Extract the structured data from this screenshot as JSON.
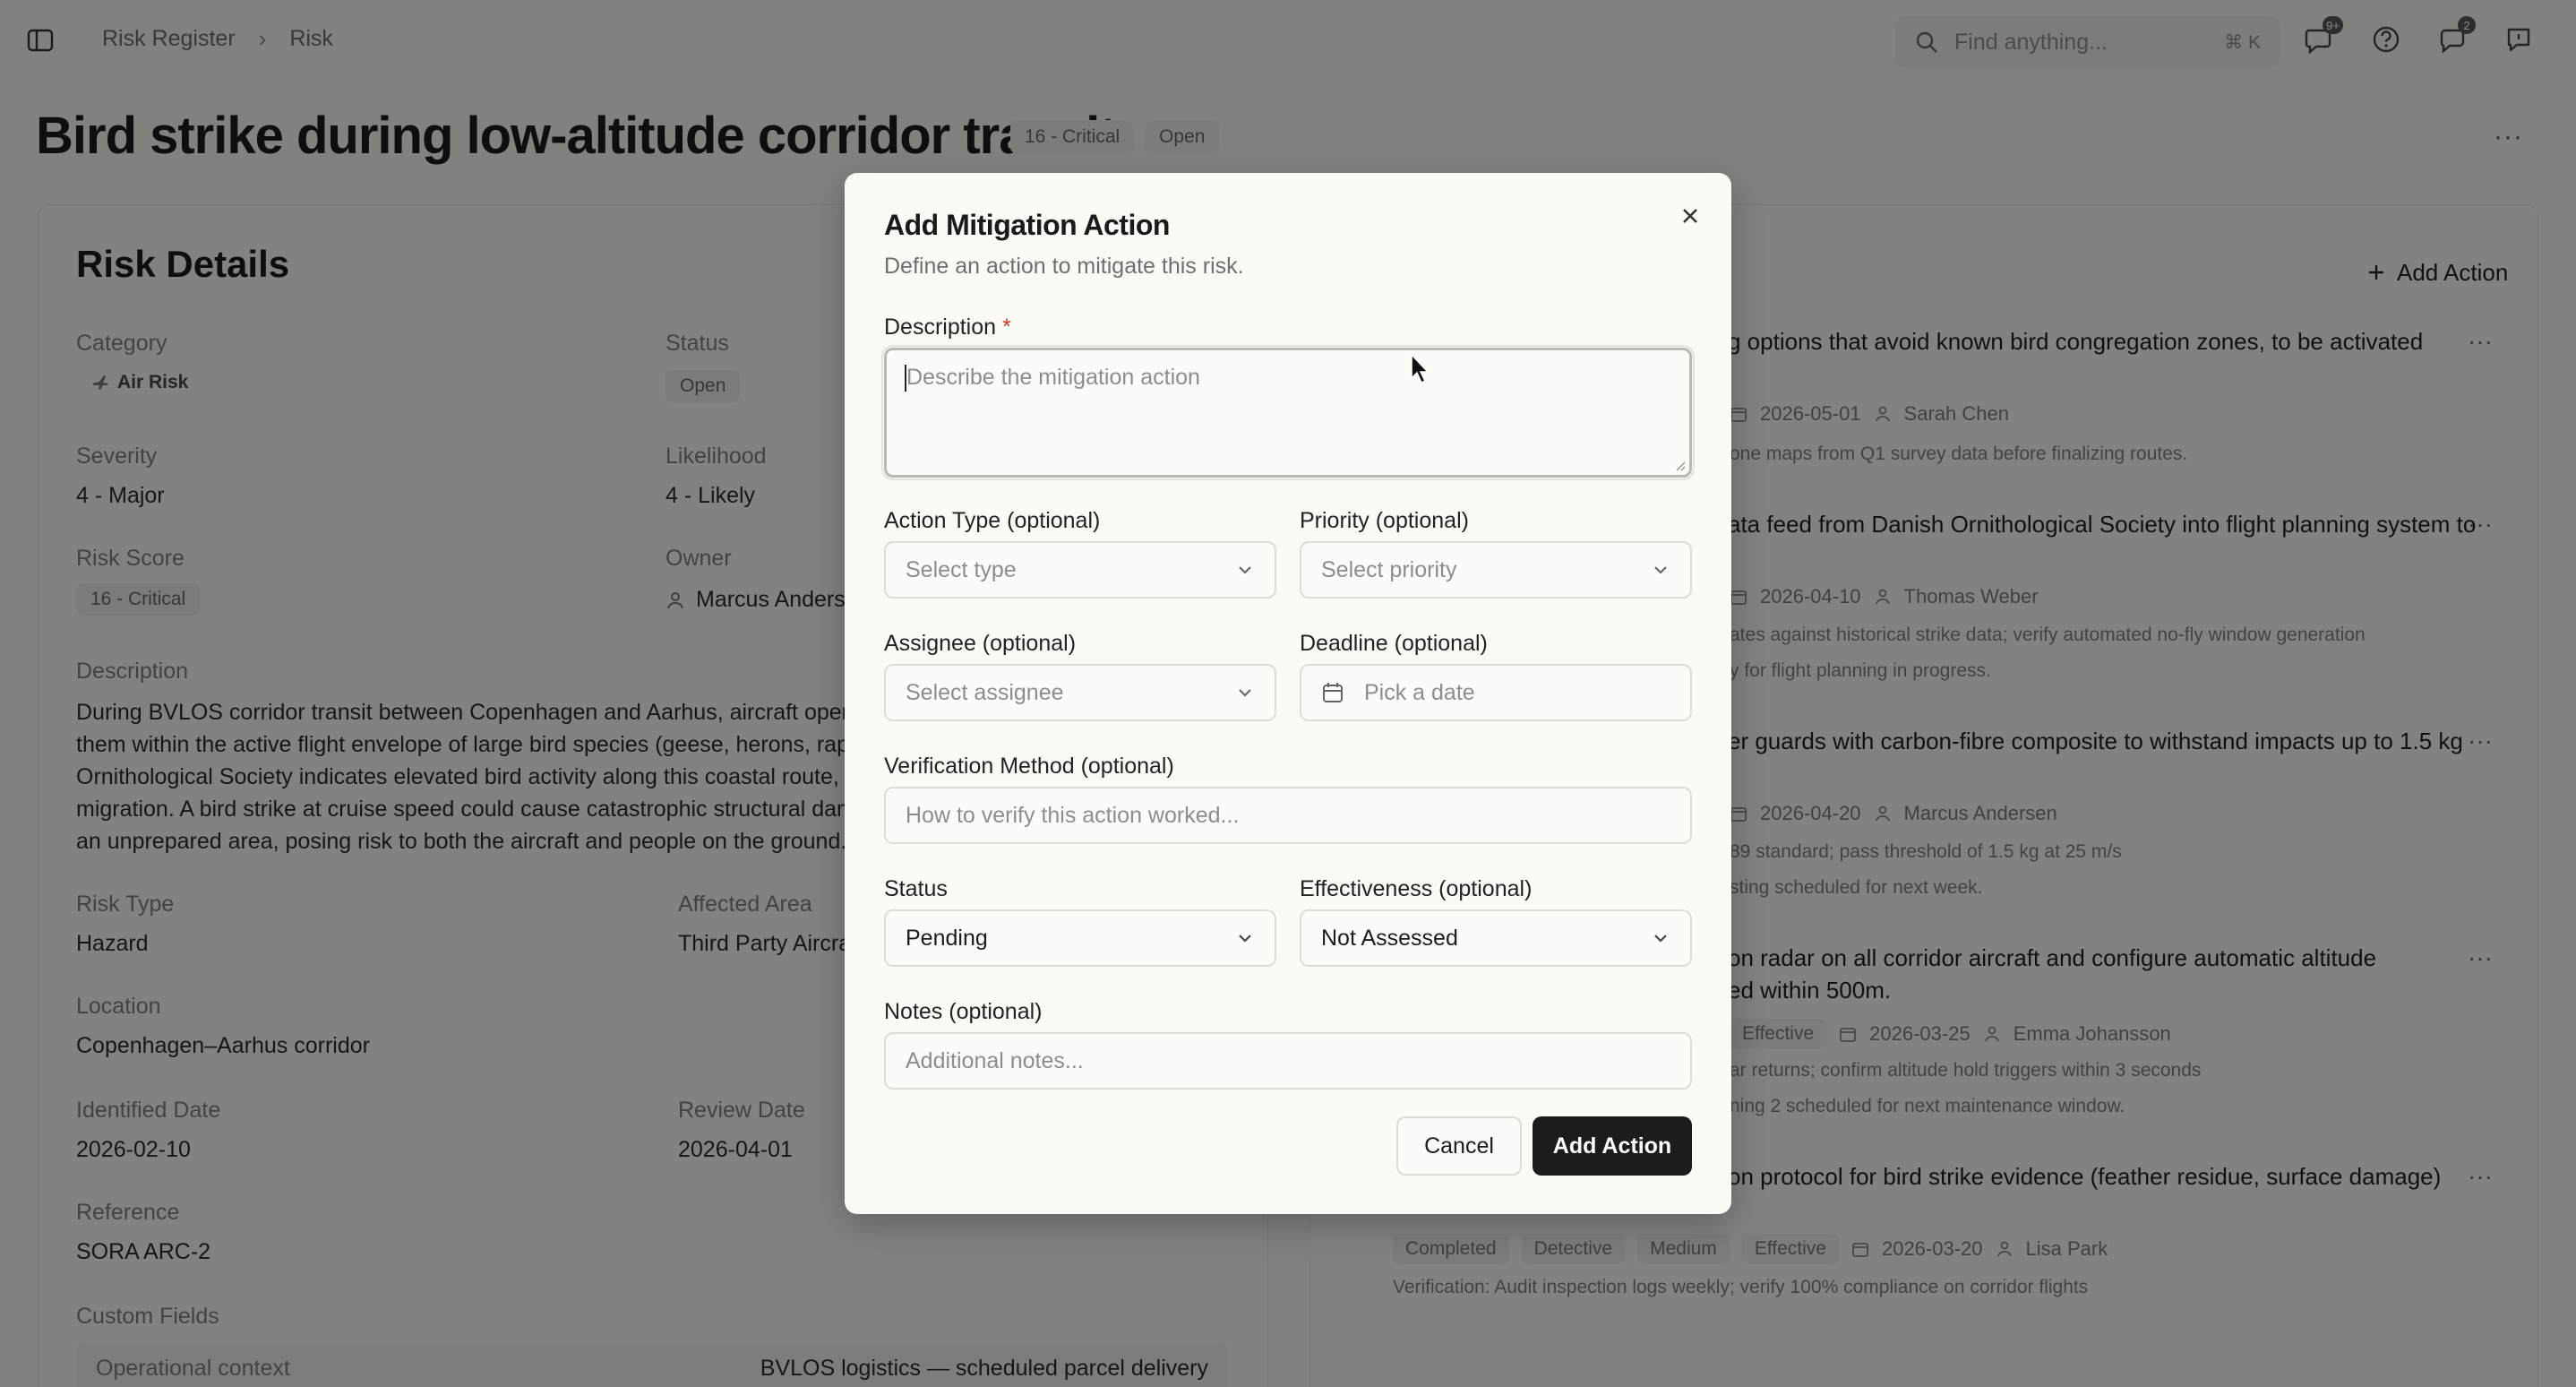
{
  "breadcrumb": [
    "Risk Register",
    "Risk"
  ],
  "search": {
    "placeholder": "Find anything...",
    "shortcut": "⌘ K"
  },
  "notifications_badge": "9+",
  "header_badge_count": "2",
  "page": {
    "title": "Bird strike during low-altitude corridor transit",
    "score_chip": "16 - Critical",
    "status_chip": "Open"
  },
  "risk_details": {
    "heading": "Risk Details",
    "category_label": "Category",
    "category_value": "Air Risk",
    "status_label": "Status",
    "status_value": "Open",
    "severity_label": "Severity",
    "severity_value": "4 - Major",
    "likelihood_label": "Likelihood",
    "likelihood_value": "4 - Likely",
    "score_label": "Risk Score",
    "score_value": "16 - Critical",
    "owner_label": "Owner",
    "owner_value": "Marcus Anders",
    "description_label": "Description",
    "description_lines": [
      "During BVLOS corridor transit between Copenhagen and Aarhus, aircraft operat",
      "them within the active flight envelope of large bird species (geese, herons, rapto",
      "Ornithological Society indicates elevated bird activity along this coastal route, p",
      "migration. A bird strike at cruise speed could cause catastrophic structural dam",
      "an unprepared area, posing risk to both the aircraft and people on the ground."
    ],
    "risk_type_label": "Risk Type",
    "risk_type_value": "Hazard",
    "affected_area_label": "Affected Area",
    "affected_area_value": "Third Party Aircra",
    "location_label": "Location",
    "location_value": "Copenhagen–Aarhus corridor",
    "identified_label": "Identified Date",
    "identified_value": "2026-02-10",
    "review_label": "Review Date",
    "review_value": "2026-04-01",
    "reference_label": "Reference",
    "reference_value": "SORA ARC-2",
    "custom_fields_label": "Custom Fields",
    "custom_field_key": "Operational context",
    "custom_field_value": "BVLOS logistics — scheduled parcel delivery"
  },
  "actions_panel": {
    "add_action_label": "Add Action",
    "items": [
      {
        "title": "g options that avoid known bird congregation zones, to be activated",
        "date": "2026-05-01",
        "assignee": "Sarah Chen",
        "notes": [
          "one maps from Q1 survey data before finalizing routes."
        ]
      },
      {
        "title": "ata feed from Danish Ornithological Society into flight planning system to",
        "date": "2026-04-10",
        "assignee": "Thomas Weber",
        "notes": [
          "ates against historical strike data; verify automated no-fly window generation",
          "y for flight planning in progress."
        ]
      },
      {
        "title": "er guards with carbon-fibre composite to withstand impacts up to 1.5 kg",
        "date": "2026-04-20",
        "assignee": "Marcus Andersen",
        "notes": [
          "89 standard; pass threshold of 1.5 kg at 25 m/s",
          "sting scheduled for next week."
        ]
      },
      {
        "title": "on radar on all corridor aircraft and configure automatic altitude",
        "title2": "ed within 500m.",
        "effectiveness": "Effective",
        "date": "2026-03-25",
        "assignee": "Emma Johansson",
        "notes": [
          "ar returns; confirm altitude hold triggers within 3 seconds",
          "ning 2 scheduled for next maintenance window."
        ]
      },
      {
        "title": "on protocol for bird strike evidence (feather residue, surface damage)",
        "status": "Completed",
        "type": "Detective",
        "priority": "Medium",
        "effectiveness": "Effective",
        "date": "2026-03-20",
        "assignee": "Lisa Park",
        "notes": [
          "Verification: Audit inspection logs weekly; verify 100% compliance on corridor flights"
        ]
      }
    ]
  },
  "modal": {
    "title": "Add Mitigation Action",
    "subtitle": "Define an action to mitigate this risk.",
    "description_label": "Description",
    "required_mark": "*",
    "description_placeholder": "Describe the mitigation action",
    "action_type_label": "Action Type (optional)",
    "action_type_placeholder": "Select type",
    "priority_label": "Priority (optional)",
    "priority_placeholder": "Select priority",
    "assignee_label": "Assignee (optional)",
    "assignee_placeholder": "Select assignee",
    "deadline_label": "Deadline (optional)",
    "deadline_placeholder": "Pick a date",
    "verification_label": "Verification Method (optional)",
    "verification_placeholder": "How to verify this action worked...",
    "status_label": "Status",
    "status_value": "Pending",
    "effectiveness_label": "Effectiveness (optional)",
    "effectiveness_value": "Not Assessed",
    "notes_label": "Notes (optional)",
    "notes_placeholder": "Additional notes...",
    "cancel_label": "Cancel",
    "submit_label": "Add Action"
  },
  "icons": [
    "sidebar-toggle-icon",
    "search-icon",
    "chat-icon",
    "help-icon",
    "update-icon",
    "feedback-icon",
    "plane-icon",
    "user-icon",
    "calendar-icon",
    "plus-icon",
    "close-icon",
    "chevron-down-icon",
    "more-icon"
  ]
}
